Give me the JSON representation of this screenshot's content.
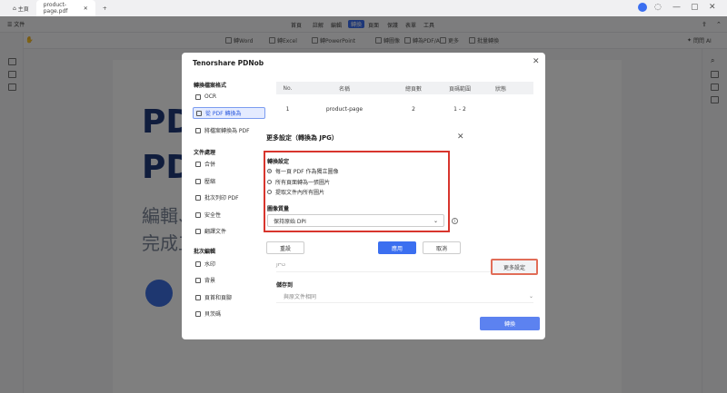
{
  "titlebar": {
    "home": "主頁",
    "tab": "product-page.pdf",
    "add": "+"
  },
  "menus": [
    "首頁",
    "註解",
    "編輯",
    "轉換",
    "頁面",
    "保護",
    "表單",
    "工具"
  ],
  "active_menu": "轉換",
  "toolbar": {
    "to_word": "轉Word",
    "to_excel": "轉Excel",
    "to_ppt": "轉PowerPoint",
    "to_image": "轉圖像",
    "to_pdfa": "轉為PDF/A",
    "more": "更多",
    "batch": "批量轉換"
  },
  "right_top": "問問 AI",
  "canvas": {
    "big1": "PD",
    "big2": "PD",
    "cjk1": "編輯、",
    "cjk2": "完成工"
  },
  "main_dialog": {
    "title": "Tenorshare PDNob",
    "sections": {
      "convert": "轉換檔案格式",
      "doc": "文件處理",
      "batch": "批次編輯"
    },
    "nav": {
      "ocr": "OCR",
      "pdf_to": "從 PDF 轉換為",
      "to_pdf": "將檔案轉換為 PDF",
      "merge": "合併",
      "compress": "壓縮",
      "print": "批次列印 PDF",
      "security": "安全性",
      "translate": "翻譯文件",
      "watermark": "水印",
      "background": "背景",
      "header": "頁首和頁腳",
      "bates": "貝茨碼"
    },
    "table": {
      "headers": [
        "No.",
        "名稱",
        "總頁數",
        "頁碼範圍",
        "狀態"
      ],
      "row": {
        "no": "1",
        "name": "product-page",
        "total": "2",
        "from": "1",
        "sep": "-",
        "to": "2"
      }
    },
    "format_value": "JPG",
    "more_settings": "更多設定",
    "save_label": "儲存到",
    "save_value": "與原文件相同",
    "convert_button": "轉換"
  },
  "sub_dialog": {
    "title": "更多設定（轉換為 JPG）",
    "convert_settings": "轉換設定",
    "options": [
      "每一頁 PDF 作為獨立圖像",
      "所有頁面轉為一張圖片",
      "提取文件內所有圖片"
    ],
    "selected_option": 0,
    "quality_label": "圖像質量",
    "quality_value": "保持原始 DPI",
    "reset": "重設",
    "apply": "應用",
    "cancel": "取消"
  },
  "colors": {
    "accent": "#5c82f0",
    "highlight_red": "#d8352d",
    "more_settings_border": "#e16d58"
  }
}
